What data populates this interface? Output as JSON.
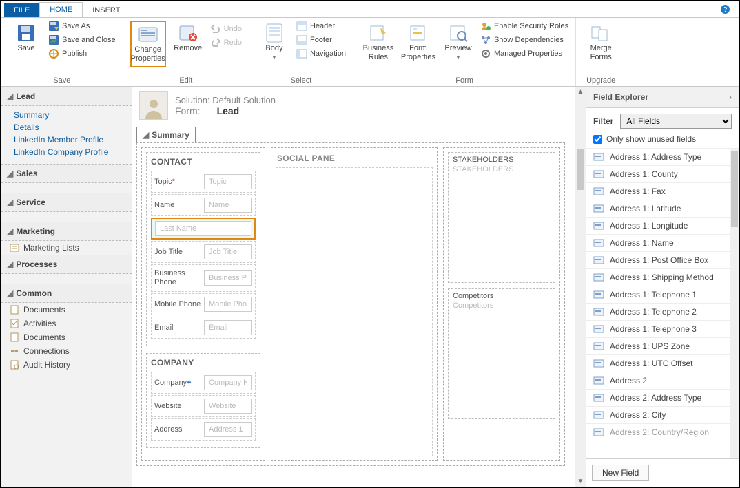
{
  "tabs": {
    "file": "FILE",
    "home": "HOME",
    "insert": "INSERT"
  },
  "ribbon": {
    "save": {
      "group": "Save",
      "save": "Save",
      "saveAs": "Save As",
      "saveClose": "Save and Close",
      "publish": "Publish"
    },
    "edit": {
      "group": "Edit",
      "changeProps": "Change\nProperties",
      "remove": "Remove",
      "undo": "Undo",
      "redo": "Redo"
    },
    "select": {
      "group": "Select",
      "body": "Body",
      "header": "Header",
      "footer": "Footer",
      "navigation": "Navigation"
    },
    "form": {
      "group": "Form",
      "bizRules": "Business\nRules",
      "formProps": "Form\nProperties",
      "preview": "Preview",
      "enableSec": "Enable Security Roles",
      "showDeps": "Show Dependencies",
      "managed": "Managed Properties"
    },
    "upgrade": {
      "group": "Upgrade",
      "merge": "Merge\nForms"
    }
  },
  "leftnav": {
    "lead": {
      "title": "Lead",
      "items": [
        "Summary",
        "Details",
        "LinkedIn Member Profile",
        "LinkedIn Company Profile"
      ]
    },
    "sections": {
      "sales": "Sales",
      "service": "Service",
      "marketing": "Marketing",
      "processes": "Processes",
      "common": "Common"
    },
    "marketingItems": [
      "Marketing Lists"
    ],
    "commonItems": [
      "Documents",
      "Activities",
      "Documents",
      "Connections",
      "Audit History"
    ]
  },
  "solution": {
    "line1": "Solution: Default Solution",
    "formLabel": "Form:",
    "formValue": "Lead"
  },
  "form": {
    "tabName": "Summary",
    "contact": {
      "title": "CONTACT",
      "fields": {
        "topic": {
          "label": "Topic",
          "placeholder": "Topic",
          "required": true
        },
        "name": {
          "label": "Name",
          "placeholder": "Name"
        },
        "lastName": {
          "label": "",
          "placeholder": "Last Name",
          "selected": true
        },
        "jobTitle": {
          "label": "Job Title",
          "placeholder": "Job Title"
        },
        "bizPhone": {
          "label": "Business Phone",
          "placeholder": "Business Phone"
        },
        "mobile": {
          "label": "Mobile Phone",
          "placeholder": "Mobile Phone"
        },
        "email": {
          "label": "Email",
          "placeholder": "Email"
        }
      }
    },
    "company": {
      "title": "COMPANY",
      "fields": {
        "company": {
          "label": "Company",
          "placeholder": "Company Name",
          "plus": true
        },
        "website": {
          "label": "Website",
          "placeholder": "Website"
        },
        "address": {
          "label": "Address",
          "placeholder": "Address 1"
        }
      }
    },
    "socialPane": "SOCIAL PANE",
    "stakeholders": {
      "title": "STAKEHOLDERS",
      "placeholder": "STAKEHOLDERS"
    },
    "competitors": {
      "title": "Competitors",
      "placeholder": "Competitors"
    }
  },
  "fieldExplorer": {
    "title": "Field Explorer",
    "filterLabel": "Filter",
    "filterValue": "All Fields",
    "onlyUnused": "Only show unused fields",
    "items": [
      "Address 1: Address Type",
      "Address 1: County",
      "Address 1: Fax",
      "Address 1: Latitude",
      "Address 1: Longitude",
      "Address 1: Name",
      "Address 1: Post Office Box",
      "Address 1: Shipping Method",
      "Address 1: Telephone 1",
      "Address 1: Telephone 2",
      "Address 1: Telephone 3",
      "Address 1: UPS Zone",
      "Address 1: UTC Offset",
      "Address 2",
      "Address 2: Address Type",
      "Address 2: City",
      "Address 2: Country/Region"
    ],
    "newField": "New Field"
  }
}
